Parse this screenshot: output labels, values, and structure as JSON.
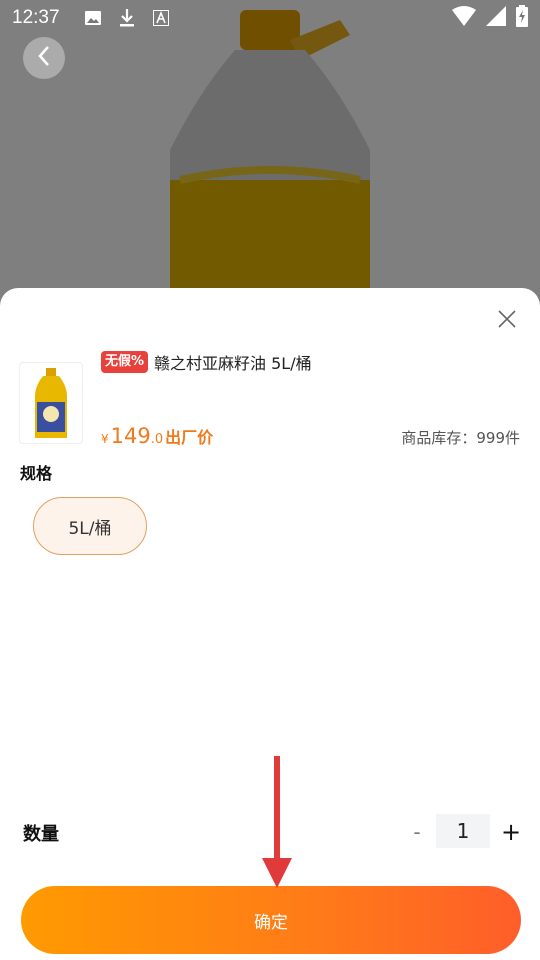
{
  "status_bar": {
    "time": "12:37",
    "icons_left": [
      "image-icon",
      "download-icon",
      "text-a-icon"
    ],
    "icons_right": [
      "wifi-icon",
      "signal-icon",
      "battery-charging-icon"
    ]
  },
  "sheet": {
    "badge": "无假%",
    "product_title": "赣之村亚麻籽油 5L/桶",
    "price": {
      "symbol": "¥",
      "integer": "149",
      "decimal": ".0",
      "tag": "出厂价"
    },
    "stock": "商品库存：999件",
    "spec_label": "规格",
    "spec_options": [
      "5L/桶"
    ],
    "quantity_label": "数量",
    "quantity_minus": "-",
    "quantity_value": "1",
    "quantity_plus": "+",
    "confirm_label": "确定"
  },
  "colors": {
    "accent": "#f07a1a",
    "badge": "#e8403a",
    "button_start": "#ff9a00",
    "button_end": "#ff5e2a",
    "arrow": "#e03a3a"
  }
}
